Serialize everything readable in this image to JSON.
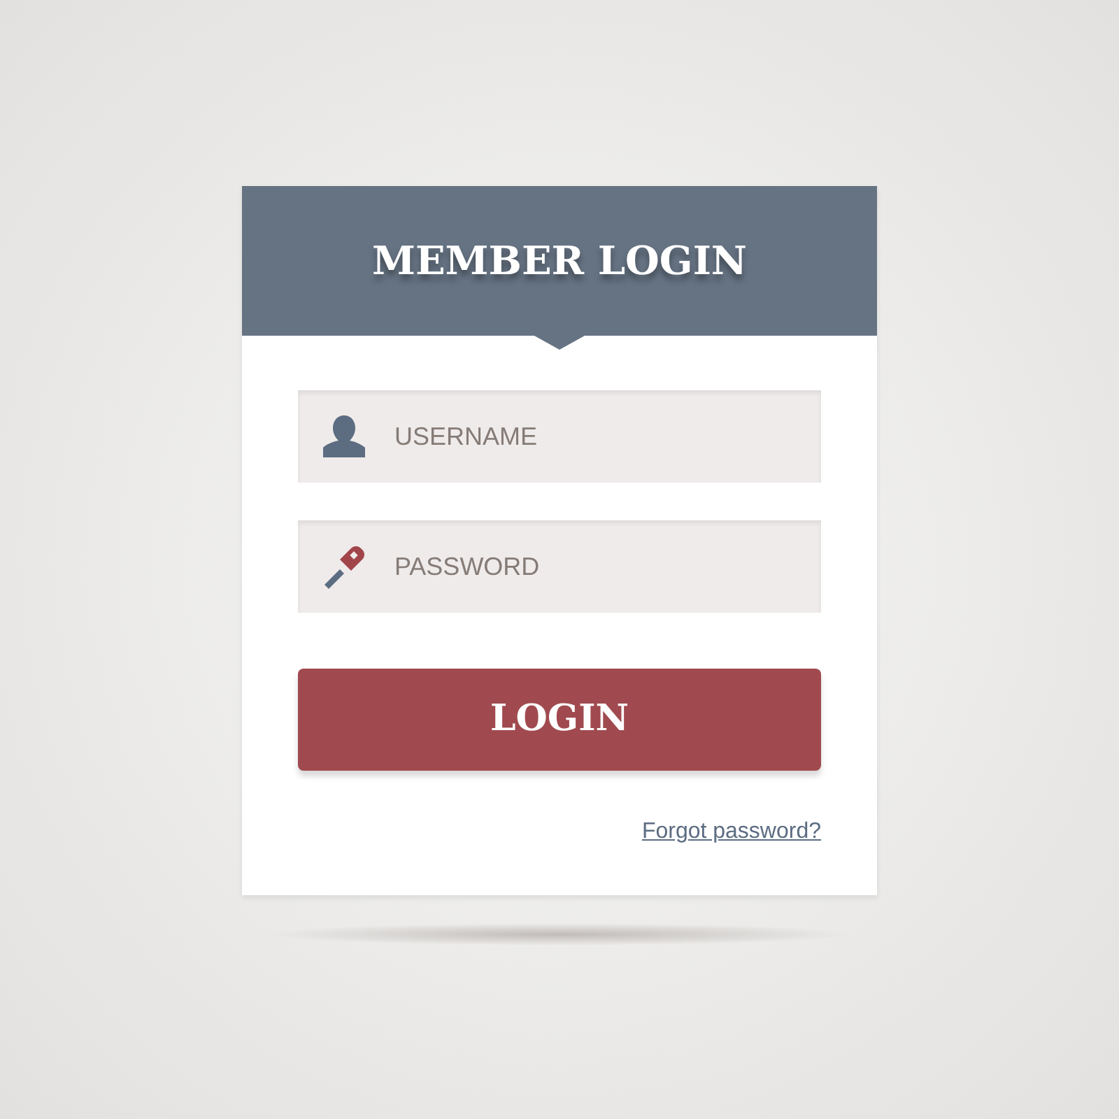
{
  "header": {
    "title": "MEMBER LOGIN"
  },
  "fields": [
    {
      "kind": "user",
      "placeholder": "USERNAME"
    },
    {
      "kind": "password",
      "placeholder": "PASSWORD"
    }
  ],
  "login_button": "LOGIN",
  "forgot_link": "Forgot password?"
}
